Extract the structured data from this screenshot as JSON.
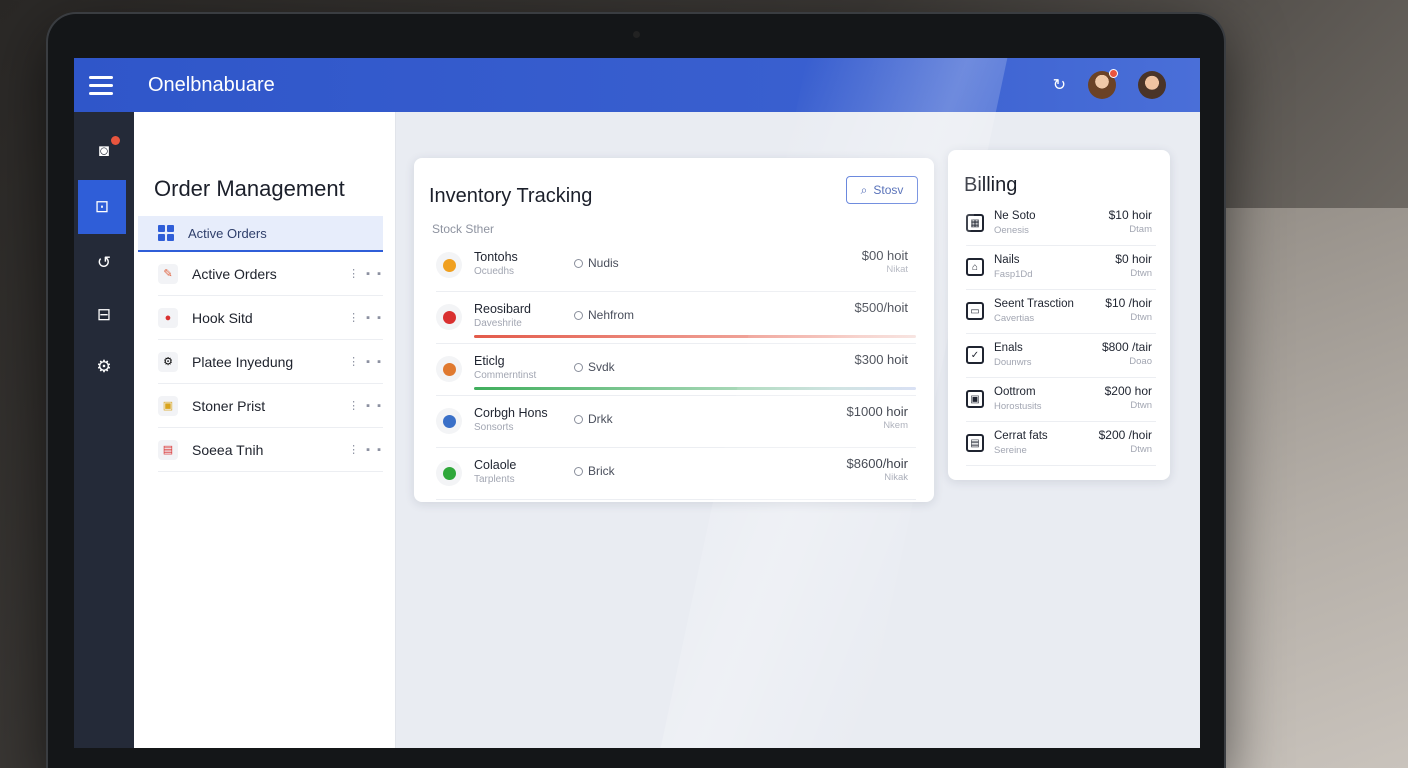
{
  "app": {
    "title": "Onelbnabuare"
  },
  "icons": {
    "menu": "hamburger-icon",
    "refresh": "refresh-icon",
    "rail": [
      "camera-icon",
      "square-icon",
      "rotate-icon",
      "scan-icon",
      "settings-icon"
    ]
  },
  "colors": {
    "topbar": "#2f56c9",
    "rail": "#242a38",
    "accent": "#2f5ed8",
    "badge": "#e8553e"
  },
  "sidebar": {
    "title": "Order Management",
    "active": "Active Orders",
    "items": [
      {
        "label": "Active Orders",
        "more": "⋮ ▪ ▪"
      },
      {
        "label": "Hook Sitd",
        "more": "⋮ ▪ ▪"
      },
      {
        "label": "Platee Inyedung",
        "more": "⋮ ▪ ▪"
      },
      {
        "label": "Stoner Prist",
        "more": "⋮ ▪ ▪"
      },
      {
        "label": "Soeea Tnih",
        "more": "⋮ ▪ ▪"
      }
    ]
  },
  "inventory": {
    "title": "Inventory Tracking",
    "button": "Stosv",
    "subtitle": "Stock Sther",
    "rows": [
      {
        "name": "Tontohs",
        "sub": "Ocuedhs",
        "status": "Nudis",
        "price": "$00 hoit",
        "price_sub": "Nikat",
        "color": "#f0a020",
        "bar": ""
      },
      {
        "name": "Reosibard",
        "sub": "Daveshrite",
        "status": "Nehfrom",
        "price": "$500/hoit",
        "price_sub": "",
        "color": "#d93030",
        "bar": "linear-gradient(90deg,#e35a4a,#f3b6ad 80%,#f6e0dc)"
      },
      {
        "name": "Eticlg",
        "sub": "Commerntinst",
        "status": "Svdk",
        "price": "$300 hoit",
        "price_sub": "",
        "color": "#e07a30",
        "bar": "linear-gradient(90deg,#3fae5c,#a8d8b8 60%,#d4dcf3)"
      },
      {
        "name": "Corbgh Hons",
        "sub": "Sonsorts",
        "status": "Drkk",
        "price": "$1000 hoir",
        "price_sub": "Nkem",
        "color": "#3a70c8",
        "bar": ""
      },
      {
        "name": "Colaole",
        "sub": "Tarplents",
        "status": "Brick",
        "price": "$8600/hoir",
        "price_sub": "Nikak",
        "color": "#2fa83a",
        "bar": ""
      }
    ]
  },
  "billing": {
    "title": "Billing",
    "rows": [
      {
        "name": "Ne Soto",
        "sub": "Oenesis",
        "price": "$10 hoir",
        "price_sub": "Dtam"
      },
      {
        "name": "Nails",
        "sub": "Fasp1Dd",
        "price": "$0 hoir",
        "price_sub": "Dtwn"
      },
      {
        "name": "Seent Trasction",
        "sub": "Cavertias",
        "price": "$10 /hoir",
        "price_sub": "Dtwn"
      },
      {
        "name": "Enals",
        "sub": "Dounwrs",
        "price": "$800 /tair",
        "price_sub": "Doao"
      },
      {
        "name": "Oottrom",
        "sub": "Horostusits",
        "price": "$200 hor",
        "price_sub": "Dtwn"
      },
      {
        "name": "Cerrat fats",
        "sub": "Sereine",
        "price": "$200 /hoir",
        "price_sub": "Dtwn"
      }
    ]
  }
}
